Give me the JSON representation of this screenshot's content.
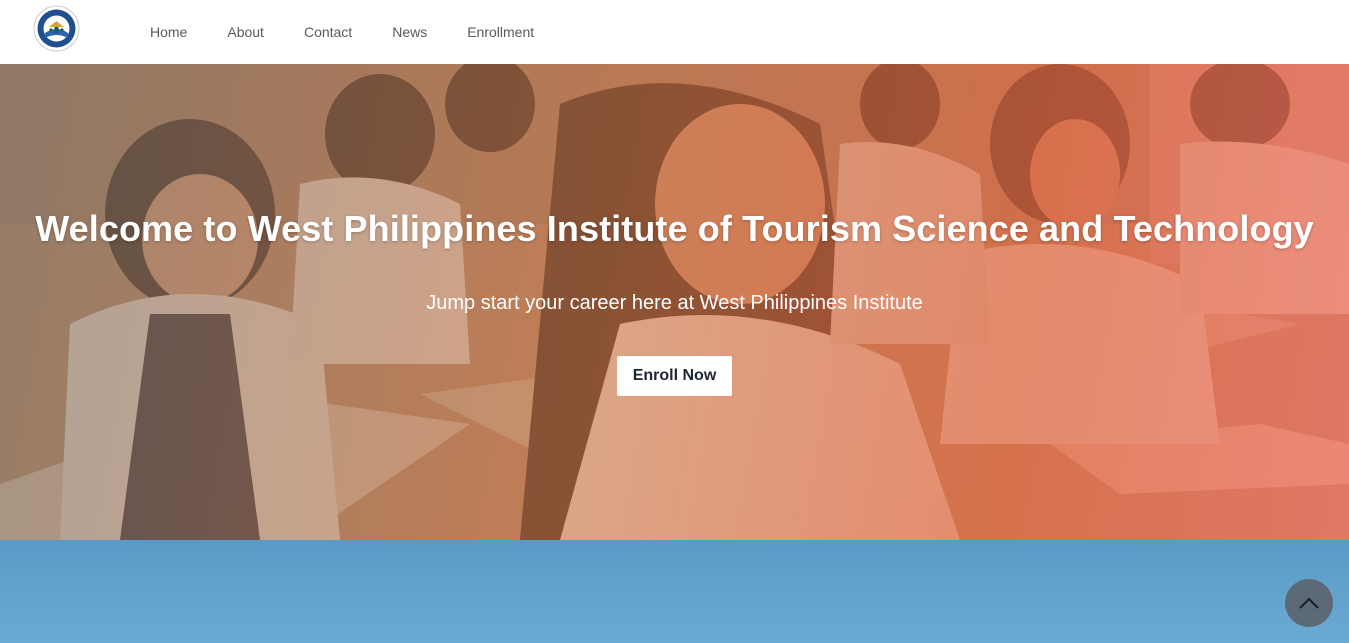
{
  "navbar": {
    "logo_alt": "West Philippines Institute seal",
    "links": [
      "Home",
      "About",
      "Contact",
      "News",
      "Enrollment"
    ]
  },
  "hero": {
    "title": "Welcome to West Philippines Institute of Tourism Science and Technology",
    "subtitle": "Jump start your career here at West Philippines Institute",
    "cta_label": "Enroll Now"
  },
  "scroll_top": {
    "icon": "chevron-up-icon"
  },
  "colors": {
    "nav_text": "#555a60",
    "overlay_warm": "#e0643c",
    "section_blue": "#5a9ac6",
    "scroll_button": "#5c6a78",
    "cta_text": "#1d2433"
  }
}
